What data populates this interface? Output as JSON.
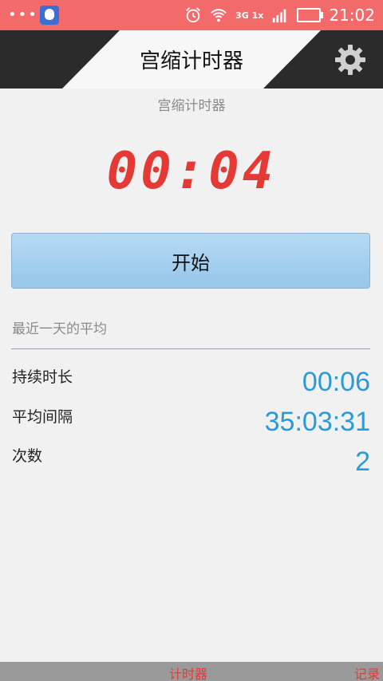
{
  "status_bar": {
    "dots": "•••",
    "network_label": "3G 1x",
    "time": "21:02"
  },
  "header": {
    "title": "宫缩计时器"
  },
  "subtitle": "宫缩计时器",
  "timer": {
    "display": "00:04"
  },
  "start_button_label": "开始",
  "stats": {
    "section_title": "最近一天的平均",
    "rows": [
      {
        "label": "持续时长",
        "value": "00:06"
      },
      {
        "label": "平均间隔",
        "value": "35:03:31"
      },
      {
        "label": "次数",
        "value": "2"
      }
    ]
  },
  "tabs": [
    {
      "label": "计时器"
    },
    {
      "label": "记录"
    }
  ],
  "colors": {
    "status_bar": "#f26a6a",
    "accent_blue": "#2a9bd6",
    "timer_red": "#e53935"
  },
  "icons": [
    "qq-icon",
    "alarm-icon",
    "wifi-icon",
    "signal-icon",
    "battery-icon",
    "gear-icon"
  ]
}
